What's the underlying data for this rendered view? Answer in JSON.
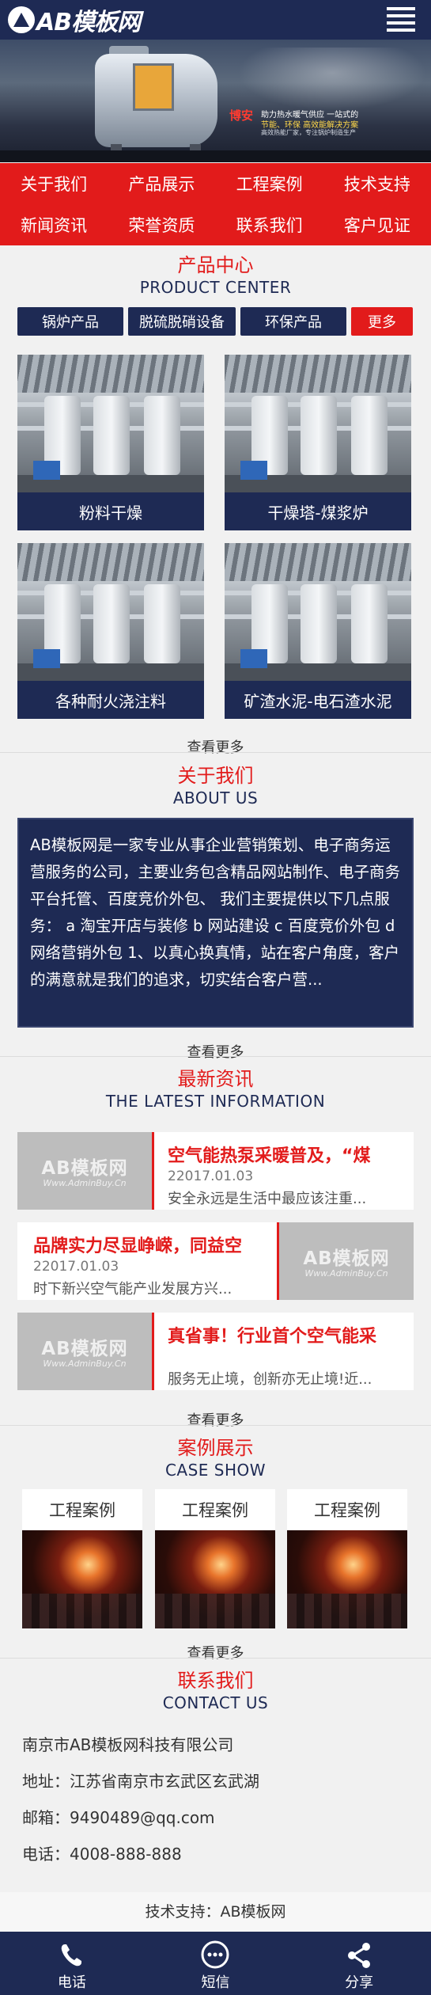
{
  "header": {
    "logo_text": "AB模板网",
    "menu_icon": "hamburger-menu-icon"
  },
  "banner": {
    "slogan": "博安",
    "line1": "助力热水暖气供应 一站式的",
    "line2": "节能、环保 高效能解决方案",
    "line3": "高效热能厂家，专注锅炉制造生产"
  },
  "nav": {
    "items": [
      "关于我们",
      "产品展示",
      "工程案例",
      "技术支持",
      "新闻资讯",
      "荣誉资质",
      "联系我们",
      "客户见证"
    ]
  },
  "products": {
    "title_cn": "产品中心",
    "title_en": "PRODUCT CENTER",
    "tabs": [
      "锅炉产品",
      "脱硫脱硝设备",
      "环保产品"
    ],
    "more_tab": "更多",
    "items": [
      {
        "name": "粉料干燥"
      },
      {
        "name": "干燥塔-煤浆炉"
      },
      {
        "name": "各种耐火浇注料"
      },
      {
        "name": "矿渣水泥-电石渣水泥"
      }
    ],
    "more_link": "查看更多"
  },
  "about": {
    "title_cn": "关于我们",
    "title_en": "ABOUT US",
    "text": "AB模板网是一家专业从事企业营销策划、电子商务运营服务的公司，主要业务包含精品网站制作、电子商务平台托管、百度竞价外包、 我们主要提供以下几点服务： a 淘宝开店与装修 b 网站建设 c 百度竞价外包 d 网络营销外包 1、以真心换真情，站在客户角度，客户的满意就是我们的追求，切实结合客户营...",
    "more_link": "查看更多"
  },
  "news": {
    "title_cn": "最新资讯",
    "title_en": "THE LATEST INFORMATION",
    "thumb_text": "AB模板网",
    "thumb_sub": "Www.AdminBuy.Cn",
    "items": [
      {
        "title": "空气能热泵采暖普及，“煤",
        "date": "22017.01.03",
        "desc": "安全永远是生活中最应该注重..."
      },
      {
        "title": "品牌实力尽显峥嵘，同益空",
        "date": "22017.01.03",
        "desc": "时下新兴空气能产业发展方兴..."
      },
      {
        "title": "真省事！行业首个空气能采",
        "date": "22017.01.03",
        "desc": "服务无止境，创新亦无止境!近..."
      }
    ],
    "more_link": "查看更多"
  },
  "cases": {
    "title_cn": "案例展示",
    "title_en": "CASE SHOW",
    "items": [
      {
        "name": "工程案例"
      },
      {
        "name": "工程案例"
      },
      {
        "name": "工程案例"
      }
    ],
    "more_link": "查看更多"
  },
  "contact": {
    "title_cn": "联系我们",
    "title_en": "CONTACT US",
    "company": "南京市AB模板网科技有限公司",
    "address": "地址：江苏省南京市玄武区玄武湖",
    "email": "邮箱：9490489@qq.com",
    "phone": "电话：4008-888-888"
  },
  "footer": {
    "support": "技术支持：AB模板网"
  },
  "bottom_bar": {
    "items": [
      {
        "label": "电话",
        "icon": "phone-icon"
      },
      {
        "label": "短信",
        "icon": "sms-icon"
      },
      {
        "label": "分享",
        "icon": "share-icon"
      }
    ]
  },
  "colors": {
    "navy": "#1e2a54",
    "red": "#e21b1b",
    "background": "#f1f1f1"
  }
}
